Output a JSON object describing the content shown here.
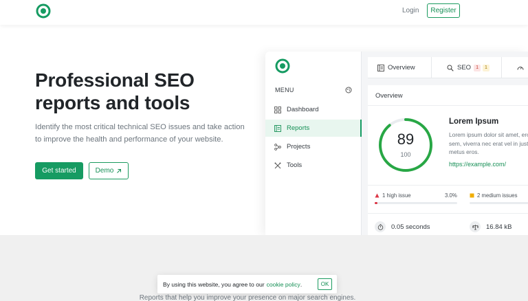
{
  "header": {
    "login_label": "Login",
    "register_label": "Register"
  },
  "hero": {
    "title_line1": "Professional SEO",
    "title_line2": "reports and tools",
    "subtitle": "Identify the most critical technical SEO issues and take action to improve the health and performance of your website.",
    "cta_primary": "Get started",
    "cta_secondary": "Demo",
    "cta_secondary_icon": "external-arrow-icon"
  },
  "preview": {
    "sidebar": {
      "menu_label": "MENU",
      "items": [
        {
          "label": "Dashboard",
          "icon": "grid-icon",
          "active": false
        },
        {
          "label": "Reports",
          "icon": "report-icon",
          "active": true
        },
        {
          "label": "Projects",
          "icon": "projects-icon",
          "active": false
        },
        {
          "label": "Tools",
          "icon": "tools-icon",
          "active": false
        }
      ]
    },
    "tabs": [
      {
        "label": "Overview",
        "icon": "overview-icon"
      },
      {
        "label": "SEO",
        "icon": "search-icon",
        "badges": [
          "1",
          "1"
        ]
      },
      {
        "label": "",
        "icon": "speed-icon"
      }
    ],
    "overview": {
      "title": "Overview",
      "score": "89",
      "score_max": "100",
      "score_fraction": 0.89,
      "site_title": "Lorem Ipsum",
      "site_description": "Lorem ipsum dolor sit amet, eros sem, viverra nec erat vel in justo metus eros.",
      "site_url": "https://example.com/",
      "issues": [
        {
          "label": "1 high issue",
          "percent": "3.0%",
          "fraction": 0.03,
          "color": "#dc3545"
        },
        {
          "label": "2 medium issues",
          "color": "#f0ad00"
        }
      ],
      "metrics": [
        {
          "label": "0.05 seconds",
          "icon": "timer-icon"
        },
        {
          "label": "16.84 kB",
          "icon": "scale-icon"
        }
      ]
    }
  },
  "lower": {
    "tagline": "Reports that help you improve your presence on major search engines."
  },
  "cookie": {
    "text": "By using this website, you agree to our",
    "link": "cookie policy",
    "link_suffix": ".",
    "ok_label": "OK"
  },
  "colors": {
    "brand": "#169b62",
    "danger": "#dc3545",
    "warning": "#f0ad00"
  }
}
